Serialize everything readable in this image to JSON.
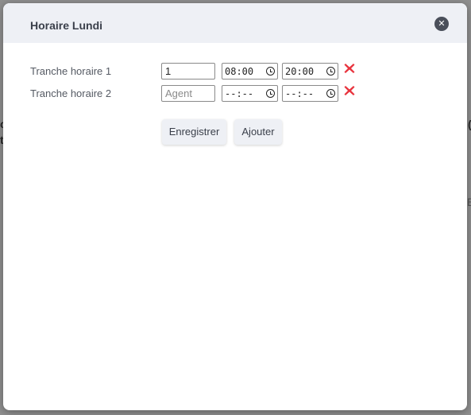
{
  "backdrop": {
    "fragment_1": "c",
    "fragment_2": "t",
    "fragment_3": "(",
    "fragment_4": "E"
  },
  "modal": {
    "title": "Horaire Lundi",
    "close_icon": "close-icon",
    "rows": [
      {
        "label": "Tranche horaire 1",
        "agent_value": "1",
        "agent_placeholder": "Agent",
        "start": "08:00",
        "end": "20:00"
      },
      {
        "label": "Tranche horaire 2",
        "agent_value": "",
        "agent_placeholder": "Agent",
        "start": "--:--",
        "end": "--:--"
      }
    ],
    "save_label": "Enregistrer",
    "add_label": "Ajouter"
  },
  "colors": {
    "header_bg": "#eef0f5",
    "delete_red": "#e8323c",
    "backdrop": "#8f8f8f"
  }
}
